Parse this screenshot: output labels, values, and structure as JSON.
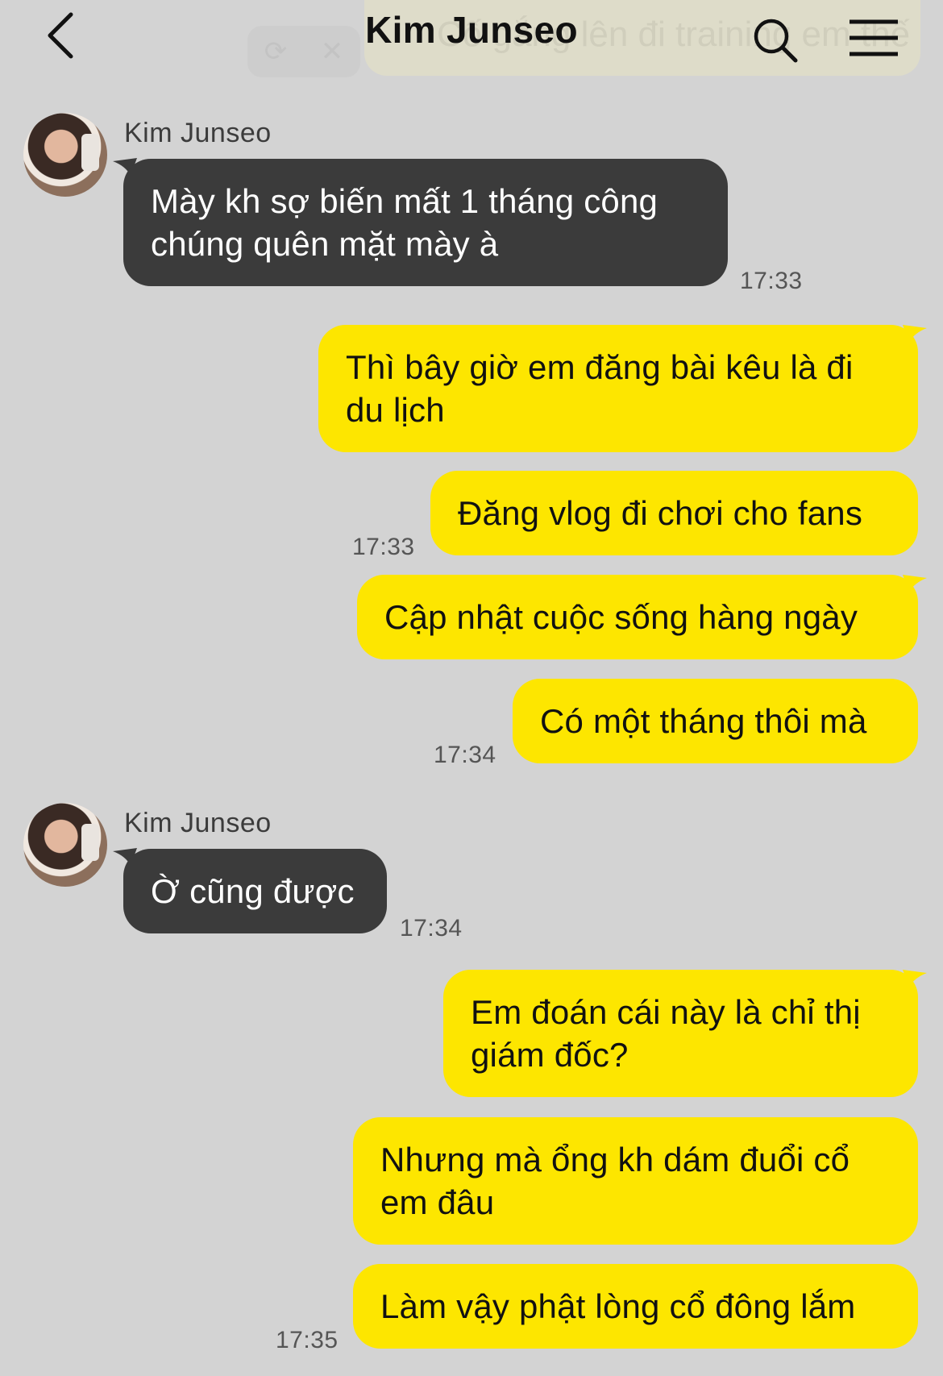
{
  "header": {
    "title": "Kim Junseo",
    "back_icon": "chevron-left-icon",
    "search_icon": "search-icon",
    "menu_icon": "hamburger-menu-icon"
  },
  "pinned": {
    "text": "Cố gắng lên đi training em thế"
  },
  "colors": {
    "background": "#d3d3d3",
    "incoming_bubble": "#3b3b3b",
    "outgoing_bubble": "#fde600"
  },
  "messages": [
    {
      "sender": "Kim Junseo",
      "text": "Mày kh sợ biến mất 1 tháng công chúng quên mặt mày à",
      "time": "17:33"
    },
    {
      "text": "Thì bây giờ em đăng bài kêu là đi du lịch"
    },
    {
      "text": "Đăng vlog đi chơi cho fans",
      "time": "17:33"
    },
    {
      "text": "Cập nhật cuộc sống hàng ngày"
    },
    {
      "text": "Có một tháng thôi mà",
      "time": "17:34"
    },
    {
      "sender": "Kim Junseo",
      "text": "Ờ cũng được",
      "time": "17:34"
    },
    {
      "text": "Em đoán cái này là chỉ thị giám đốc?"
    },
    {
      "text": "Nhưng mà ổng kh dám đuổi cổ em đâu"
    },
    {
      "text": "Làm vậy phật lòng cổ đông lắm",
      "time": "17:35"
    }
  ]
}
